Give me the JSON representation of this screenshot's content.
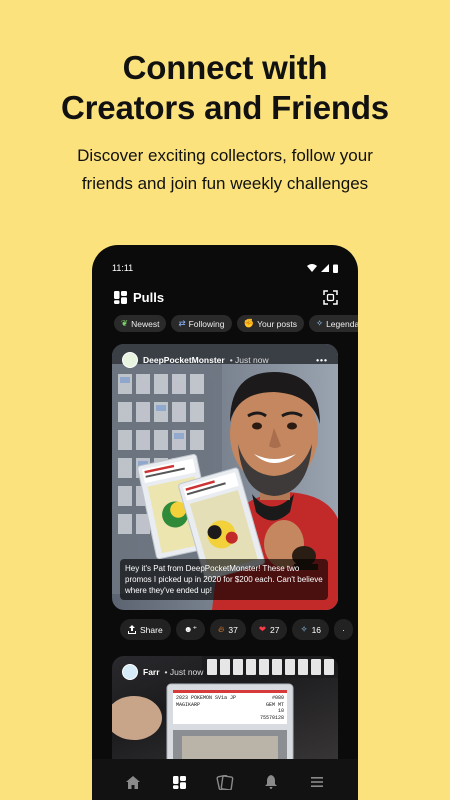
{
  "headline": {
    "line1": "Connect with",
    "line2": "Creators and Friends"
  },
  "subline": {
    "line1": "Discover exciting collectors, follow your",
    "line2": "friends and join fun weekly challenges"
  },
  "status_bar": {
    "time": "11:11"
  },
  "app": {
    "name": "Pulls"
  },
  "filters": [
    {
      "label": "Newest",
      "icon": "sprout-icon"
    },
    {
      "label": "Following",
      "icon": "swap-icon"
    },
    {
      "label": "Your posts",
      "icon": "hand-icon"
    },
    {
      "label": "Legendary",
      "icon": "sparkle-icon"
    }
  ],
  "post1": {
    "username": "DeepPocketMonster",
    "time": "• Just now",
    "caption": "Hey it's Pat from DeepPocketMonster! These two promos I picked up in 2020 for $200 each. Can't believe where they've ended up!"
  },
  "actions": {
    "share_label": "Share",
    "fire_count": "37",
    "heart_count": "27",
    "legendary_count": "16"
  },
  "post2": {
    "username": "Farr",
    "time": "• Just now",
    "slab_line1": "2023 POKEMON SV1a JP",
    "slab_line2": "MAGIKARP",
    "slab_grade1": "#080",
    "slab_grade2": "GEM MT",
    "slab_grade3": "10",
    "slab_cert": "75570128"
  },
  "colors": {
    "background": "#FBE27C",
    "phone": "#0b0b0b",
    "chip": "#2a2a2a"
  }
}
